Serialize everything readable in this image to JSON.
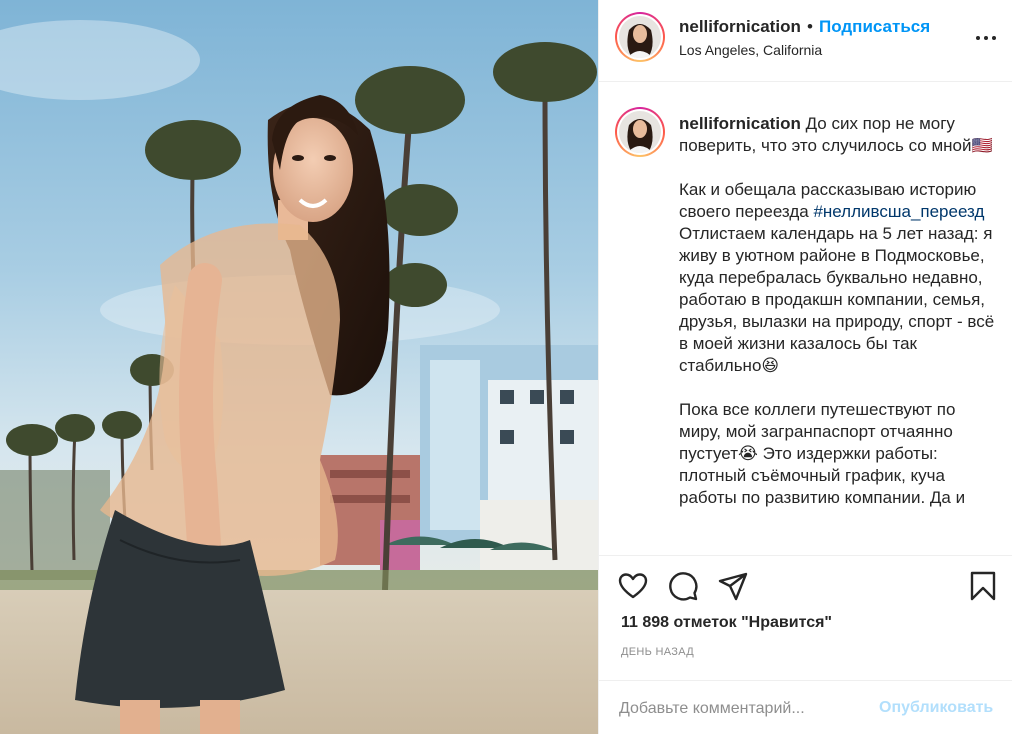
{
  "post": {
    "username": "nellifornication",
    "follow_separator": "•",
    "follow_label": "Подписаться",
    "location": "Los Angeles, California",
    "more_icon": "more-horizontal-icon"
  },
  "caption": {
    "username": "nellifornication",
    "paragraphs": [
      {
        "text": "До сих пор не могу поверить, что это случилось со мной🇺🇸"
      },
      {
        "before": "Как и обещала рассказываю историю своего переезда ",
        "hashtag": "#нелливсша_переезд",
        "after": " Отлистаем календарь на 5 лет назад: я живу в уютном районе в Подмосковье, куда перебралась буквально недавно, работаю в продакшн компании, семья, друзья, вылазки на природу, спорт - всё в моей жизни казалось бы так стабильно😆"
      },
      {
        "text": "Пока все коллеги путешествуют по миру, мой загранпаспорт отчаянно пустует😭 Это издержки работы: плотный съёмочный график, куча работы по развитию компании. Да и"
      }
    ]
  },
  "actions": {
    "like_icon": "heart-icon",
    "comment_icon": "comment-icon",
    "share_icon": "paper-plane-icon",
    "save_icon": "bookmark-icon",
    "likes_text": "11 898 отметок \"Нравится\"",
    "time_text": "День назад"
  },
  "comment": {
    "placeholder": "Добавьте комментарий...",
    "publish_label": "Опубликовать"
  },
  "colors": {
    "accent": "#0095f6",
    "publish_disabled": "#b2dffc",
    "hashtag": "#00376b",
    "muted": "#8e8e8e",
    "text": "#262626"
  }
}
